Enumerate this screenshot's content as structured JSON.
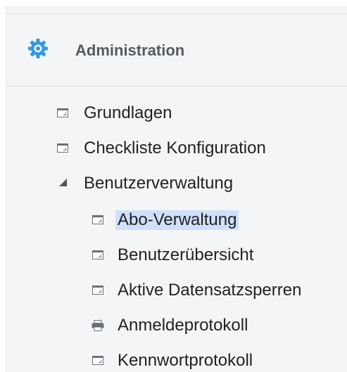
{
  "header": {
    "title": "Administration",
    "icon": "gear-icon",
    "icon_color": "#3399dd"
  },
  "tree": {
    "items": [
      {
        "label": "Grundlagen",
        "icon": "window-icon",
        "level": 1
      },
      {
        "label": "Checkliste Konfiguration",
        "icon": "window-icon",
        "level": 1
      },
      {
        "label": "Benutzerverwaltung",
        "icon": "expanded-triangle-icon",
        "level": 1,
        "expanded": true
      },
      {
        "label": "Abo-Verwaltung",
        "icon": "window-icon",
        "level": 2,
        "selected": true
      },
      {
        "label": "Benutzerübersicht",
        "icon": "window-icon",
        "level": 2
      },
      {
        "label": "Aktive Datensatzsperren",
        "icon": "window-icon",
        "level": 2
      },
      {
        "label": "Anmeldeprotokoll",
        "icon": "printer-icon",
        "level": 2
      },
      {
        "label": "Kennwortprotokoll",
        "icon": "window-icon",
        "level": 2
      }
    ]
  },
  "colors": {
    "selected_bg": "#cfe0fb",
    "panel_bg": "#f4f5f7"
  }
}
